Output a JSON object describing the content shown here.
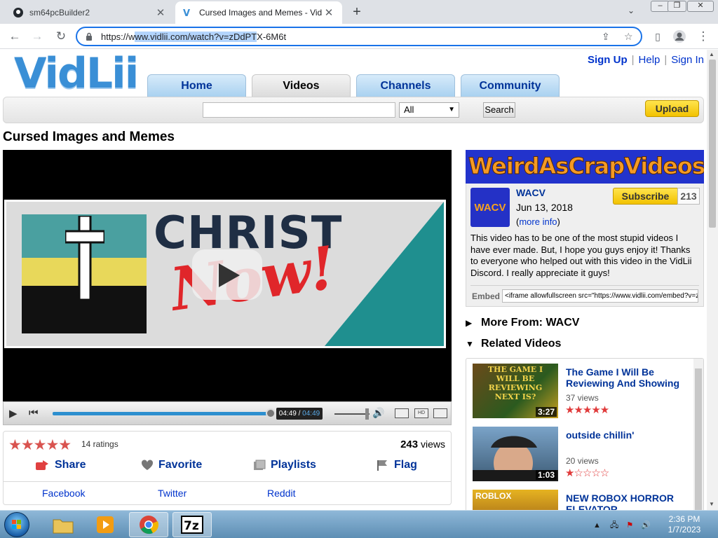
{
  "browser": {
    "tabs": [
      {
        "title": "sm64pcBuilder2",
        "active": false
      },
      {
        "title": "Cursed Images and Memes - Vid",
        "active": true
      }
    ],
    "new_tab": "+",
    "url_prefix": "https://w",
    "url_selected": "ww.vidlii.com/watch?v=zDdPT",
    "url_suffix": "X-6M6t"
  },
  "site": {
    "logo": "VidLii",
    "top_links": {
      "sign_up": "Sign Up",
      "help": "Help",
      "sign_in": "Sign In"
    },
    "nav": [
      "Home",
      "Videos",
      "Channels",
      "Community"
    ],
    "search": {
      "category": "All",
      "button": "Search"
    },
    "upload": "Upload"
  },
  "video": {
    "title": "Cursed Images and Memes",
    "thumb_text_1": "CHRIST",
    "thumb_text_2": "Now!",
    "time_current": "04:49",
    "time_sep": " / ",
    "time_total": "04:49",
    "rating": 5,
    "ratings_count": "14 ratings",
    "views_count": "243",
    "views_label": " views",
    "actions": {
      "share": "Share",
      "favorite": "Favorite",
      "playlists": "Playlists",
      "flag": "Flag"
    },
    "share_links": [
      "Facebook",
      "Twitter",
      "Reddit"
    ]
  },
  "channel": {
    "banner": "WeirdAsCrapVideos",
    "avatar_text": "WACV",
    "name": "WACV",
    "date": "Jun 13, 2018",
    "more_info_open": "(",
    "more_info": "more info",
    "more_info_close": ")",
    "subscribe": "Subscribe",
    "subscribers": "213",
    "description": "This video has to be one of the most stupid videos I have ever made. But, I hope you guys enjoy it! Thanks to everyone who helped out with this video in the VidLii Discord. I really appreciate it guys!",
    "embed_label": "Embed",
    "embed_code": "<iframe allowfullscreen src=\"https://www.vidlii.com/embed?v=z"
  },
  "sidebar": {
    "more_from": "More From: WACV",
    "related_heading": "Related Videos",
    "related": [
      {
        "title": "The Game I Will Be Reviewing And Showing",
        "views": "37 views",
        "duration": "3:27",
        "rating": 5,
        "thumb_text": "THE GAME I WILL BE REVIEWING NEXT IS?"
      },
      {
        "title": "outside chillin'",
        "views": "20 views",
        "duration": "1:03",
        "rating": 1
      },
      {
        "title": "NEW ROBOX HORROR ELEVATOR",
        "views": "",
        "duration": "",
        "rating": 0,
        "thumb_text": "ROBLOX"
      }
    ]
  },
  "taskbar": {
    "time": "2:36 PM",
    "date": "1/7/2023",
    "apps": [
      "explorer",
      "media-player",
      "chrome",
      "7zip"
    ]
  },
  "colors": {
    "link": "#003399",
    "accent_blue": "#2d8fcf",
    "star_red": "#d9534f",
    "upload_yellow": "#f2c200"
  }
}
